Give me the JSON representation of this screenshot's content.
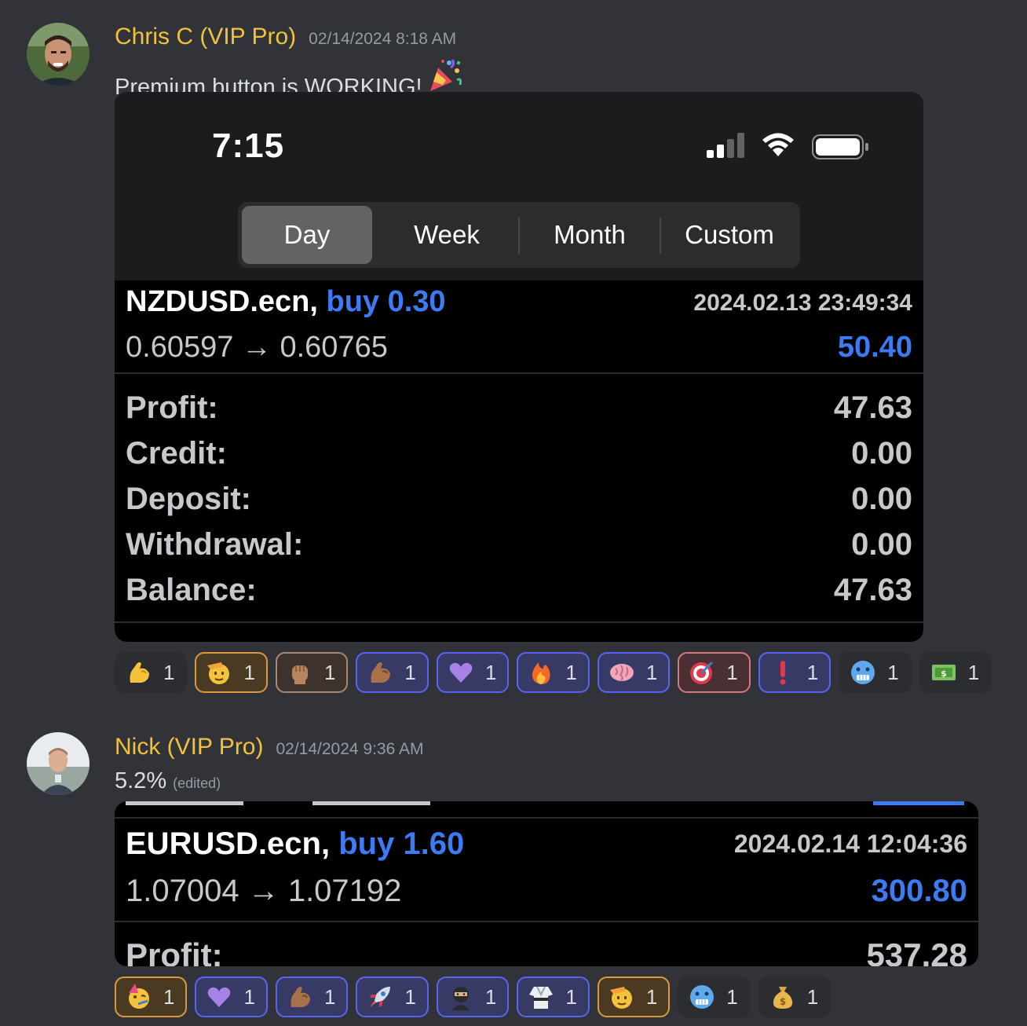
{
  "messages": [
    {
      "username": "Chris C (VIP Pro)",
      "timestamp": "02/14/2024 8:18 AM",
      "text": "Premium button is WORKING!",
      "text_emoji": "party-popper",
      "attachment": {
        "status_time": "7:15",
        "segments": [
          "Day",
          "Week",
          "Month",
          "Custom"
        ],
        "active_segment": "Day",
        "trade": {
          "symbol": "NZDUSD.ecn,",
          "side": "buy 0.30",
          "datetime": "2024.02.13 23:49:34",
          "prices": "0.60597 → 0.60765",
          "pl": "50.40"
        },
        "summary": [
          {
            "label": "Profit:",
            "value": "47.63"
          },
          {
            "label": "Credit:",
            "value": "0.00"
          },
          {
            "label": "Deposit:",
            "value": "0.00"
          },
          {
            "label": "Withdrawal:",
            "value": "0.00"
          },
          {
            "label": "Balance:",
            "value": "47.63"
          }
        ]
      },
      "reactions": [
        {
          "emoji": "flexed-biceps-icon",
          "count": "1",
          "style": "plain"
        },
        {
          "emoji": "saluting-face-icon",
          "count": "1",
          "style": "orange"
        },
        {
          "emoji": "raised-fist-icon",
          "count": "1",
          "style": "brown"
        },
        {
          "emoji": "flexed-biceps-medium-icon",
          "count": "1",
          "style": "me"
        },
        {
          "emoji": "purple-heart-icon",
          "count": "1",
          "style": "me"
        },
        {
          "emoji": "fire-icon",
          "count": "1",
          "style": "me"
        },
        {
          "emoji": "brain-icon",
          "count": "1",
          "style": "me"
        },
        {
          "emoji": "bullseye-icon",
          "count": "1",
          "style": "red"
        },
        {
          "emoji": "exclamation-icon",
          "count": "1",
          "style": "me"
        },
        {
          "emoji": "cold-face-icon",
          "count": "1",
          "style": "plain"
        },
        {
          "emoji": "dollar-banknote-icon",
          "count": "1",
          "style": "plain"
        }
      ]
    },
    {
      "username": "Nick (VIP Pro)",
      "timestamp": "02/14/2024 9:36 AM",
      "text": "5.2%",
      "edited": "(edited)",
      "attachment": {
        "trade": {
          "symbol": "EURUSD.ecn,",
          "side": "buy 1.60",
          "datetime": "2024.02.14 12:04:36",
          "prices": "1.07004 → 1.07192",
          "pl": "300.80"
        },
        "summary": [
          {
            "label": "Profit:",
            "value": "537.28"
          }
        ]
      },
      "reactions": [
        {
          "emoji": "partying-face-icon",
          "count": "1",
          "style": "orange"
        },
        {
          "emoji": "purple-heart-icon",
          "count": "1",
          "style": "me"
        },
        {
          "emoji": "flexed-biceps-medium-icon",
          "count": "1",
          "style": "me"
        },
        {
          "emoji": "rocket-icon",
          "count": "1",
          "style": "me"
        },
        {
          "emoji": "ninja-icon",
          "count": "1",
          "style": "me"
        },
        {
          "emoji": "martial-arts-uniform-icon",
          "count": "1",
          "style": "me"
        },
        {
          "emoji": "saluting-face-icon",
          "count": "1",
          "style": "orange"
        },
        {
          "emoji": "cold-face-icon",
          "count": "1",
          "style": "plain"
        },
        {
          "emoji": "money-bag-icon",
          "count": "1",
          "style": "plain"
        }
      ]
    }
  ]
}
